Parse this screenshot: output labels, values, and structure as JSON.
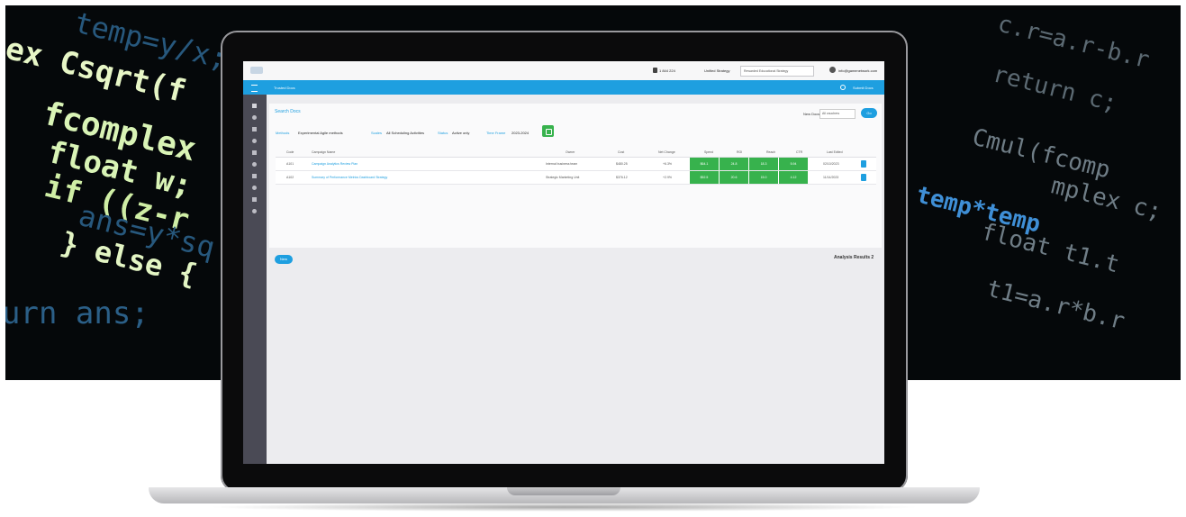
{
  "app": {
    "logo_text": "",
    "header_phone": "1 844 224",
    "header_label": "Unified Strategy",
    "header_select": "Rewarded Educational Strategy",
    "user_name": "info@gamenetwork.com",
    "nav_title": "Trusted Docs",
    "nav_right": "Submit Docs"
  },
  "page": {
    "title": "Search Docs",
    "new_docs_label": "New Docs",
    "new_docs_value": "All vouchers",
    "go_button": "Go",
    "filters": [
      {
        "label": "Methods",
        "value": "Experimental Agile methods"
      },
      {
        "label": "Scales",
        "value": "All Scheduling Activities"
      },
      {
        "label": "Status",
        "value": "Active only"
      },
      {
        "label": "Time Frame",
        "value": "2023-2024"
      }
    ],
    "filter_button_icon": "filter-icon",
    "table": {
      "headers": [
        "Code",
        "Campaign Name",
        "Owner",
        "Cost",
        "Net Change",
        "Spend",
        "ROI",
        "Reach",
        "CTR",
        "Last Edited"
      ],
      "rows": [
        {
          "code": "A101",
          "name": "Campaign Analytics Review Plan",
          "owner": "Internal business team",
          "cost": "$480.25",
          "net": "+6.3%",
          "spend": "$64.1",
          "roi": "24.8",
          "reach": "18.3",
          "ctr": "5.94",
          "edited": "02/10/2023"
        },
        {
          "code": "A102",
          "name": "Summary of Performance Metrics Dashboard Strategy",
          "owner": "Strategic Marketing Unit",
          "cost": "$376.12",
          "net": "+2.9%",
          "spend": "$52.5",
          "roi": "20.6",
          "reach": "15.0",
          "ctr": "4.12",
          "edited": "11/14/2023"
        }
      ]
    },
    "new_button": "New",
    "results_label": "Analysis Results 2"
  },
  "colors": {
    "accent": "#1e9fe0",
    "success": "#37b24d",
    "sidebar": "#4a4a55",
    "code_green": "#d8f5a8",
    "code_blue": "#2f7ab8"
  },
  "background_code": [
    "ex Csqrt(f",
    "fcomplex",
    "float w;",
    "if ((z-r",
    "} else {",
    "temp=y/x;",
    "ans=y*sq",
    "urn ans;",
    "Cmul(fcomp",
    "float t1.t",
    "t1=a.r*b.r",
    "c.r=a.r-b.r",
    "return c;",
    "temp*temp",
    "mplex c;"
  ]
}
